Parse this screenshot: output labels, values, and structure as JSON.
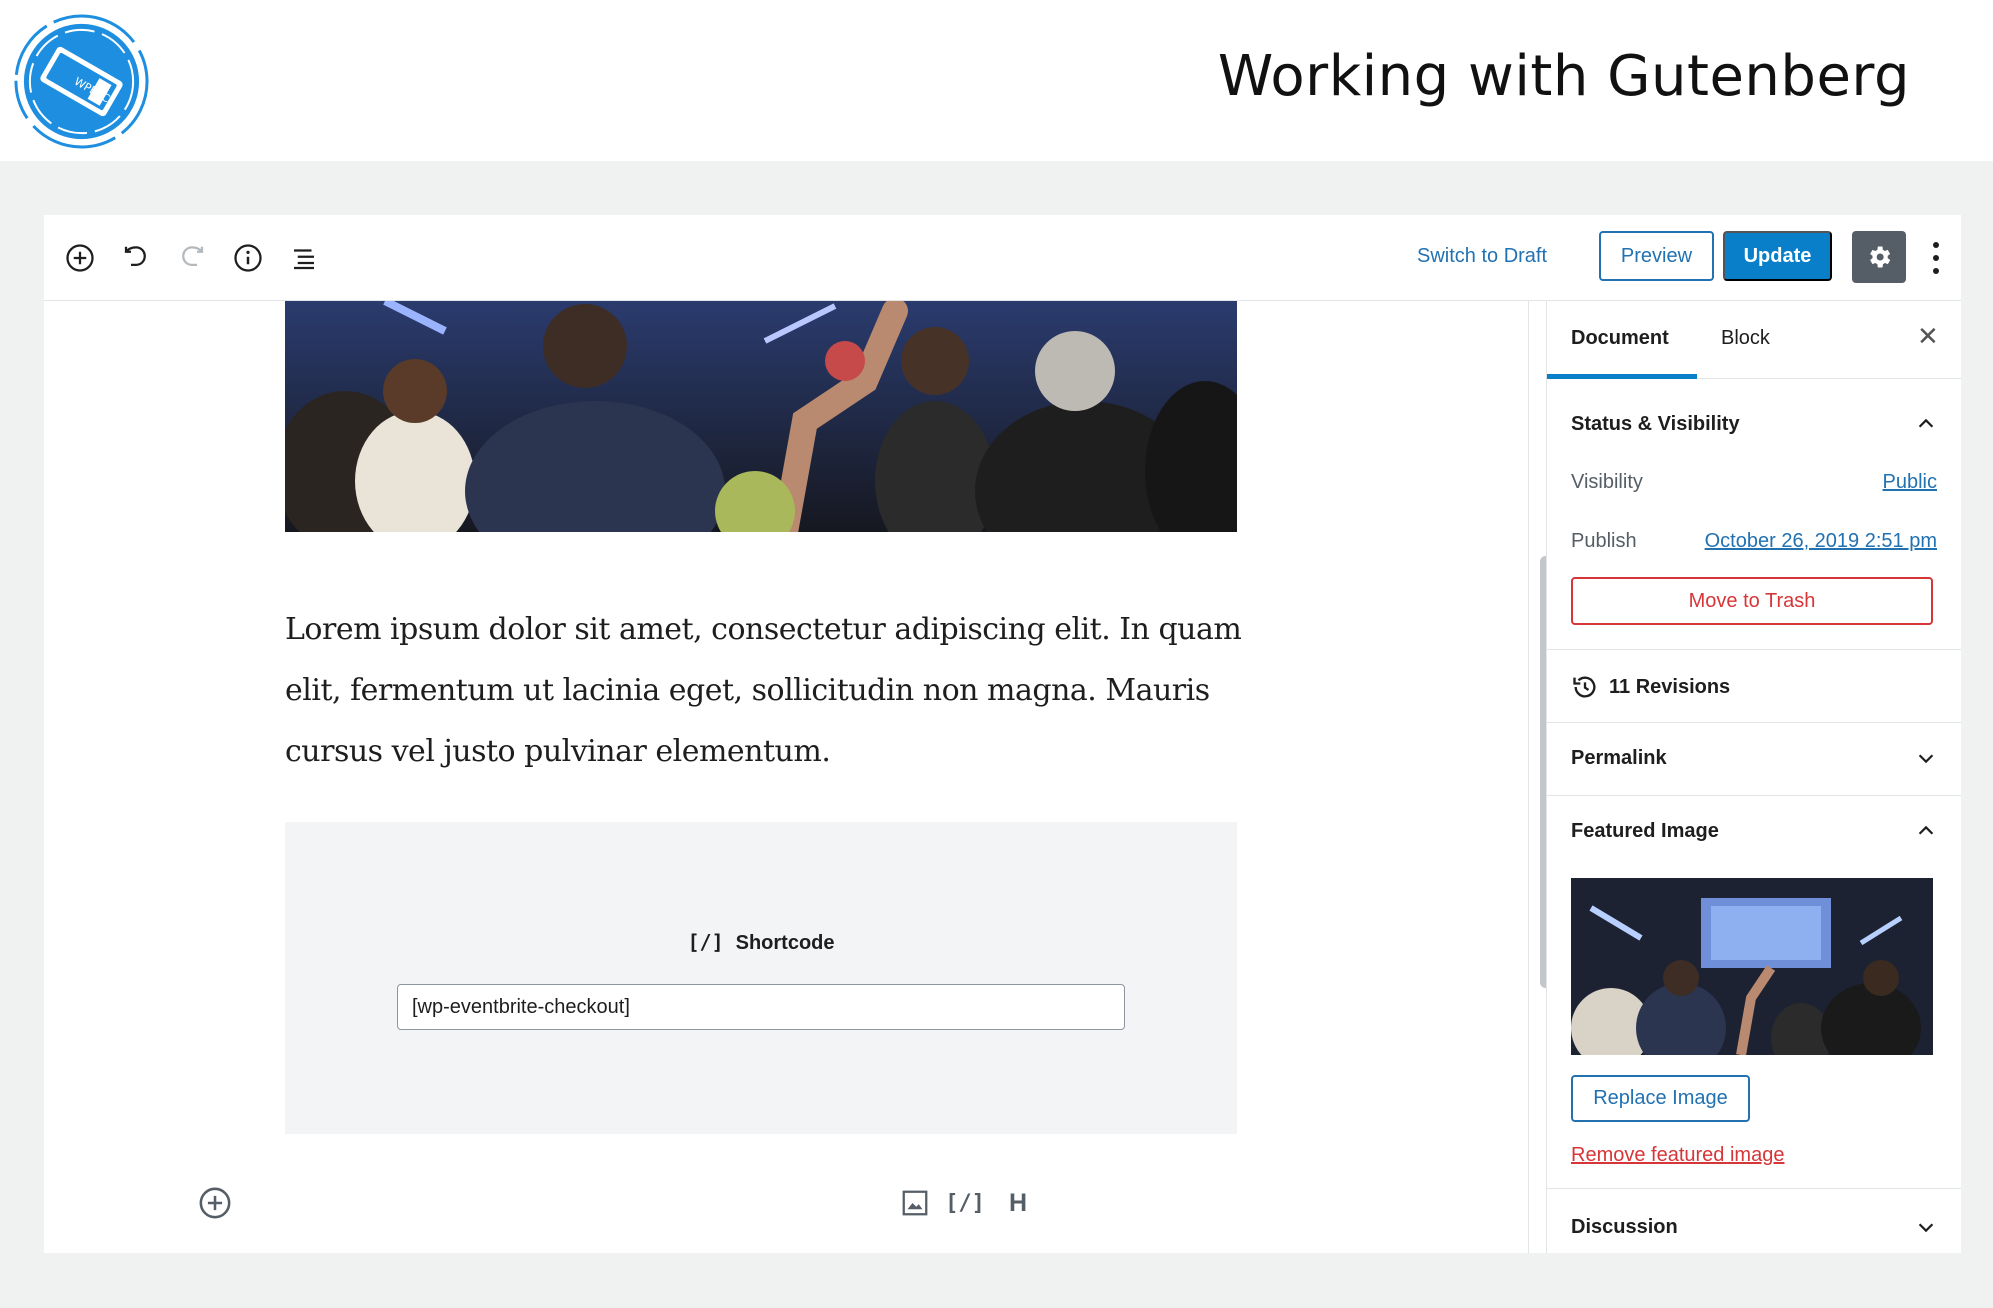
{
  "slide": {
    "title": "Working with Gutenberg",
    "logo_text": "WPEEC"
  },
  "toolbar": {
    "icons": [
      "add-block-icon",
      "undo-icon",
      "redo-icon",
      "info-icon",
      "outline-icon"
    ],
    "switch_to_draft": "Switch to Draft",
    "preview": "Preview",
    "update": "Update",
    "settings_icon": "gear-icon",
    "more_icon": "vertical-ellipsis-icon"
  },
  "content": {
    "paragraph": "Lorem ipsum dolor sit amet, consectetur adipiscing elit. In quam elit, fermentum ut lacinia eget, sollicitudin non magna. Mauris cursus vel justo pulvinar elementum.",
    "shortcode": {
      "glyph": "[/]",
      "label": "Shortcode",
      "value": "[wp-eventbrite-checkout]"
    },
    "quick_inserters": {
      "shortcode_glyph": "[/]",
      "heading_glyph": "H"
    }
  },
  "sidebar": {
    "tabs": {
      "document": "Document",
      "block": "Block"
    },
    "close": "✕",
    "status": {
      "heading": "Status & Visibility",
      "visibility_label": "Visibility",
      "visibility_value": "Public",
      "publish_label": "Publish",
      "publish_value": "October 26, 2019 2:51 pm",
      "trash": "Move to Trash"
    },
    "revisions": "11 Revisions",
    "permalink": "Permalink",
    "featured_image": {
      "heading": "Featured Image",
      "replace": "Replace Image",
      "remove": "Remove featured image"
    },
    "discussion": "Discussion"
  },
  "colors": {
    "accent": "#0a7fc9",
    "link": "#2271b1",
    "danger": "#d63638",
    "settings_bg": "#555d66"
  }
}
